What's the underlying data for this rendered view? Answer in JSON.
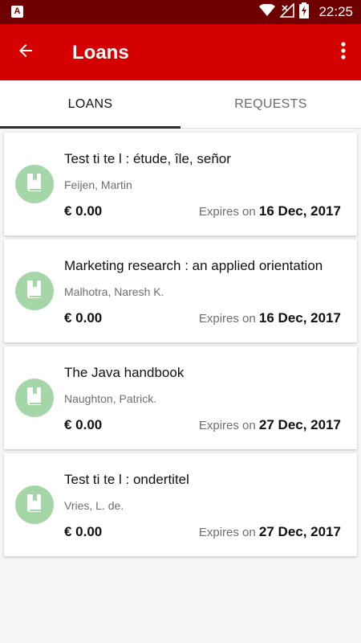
{
  "status_bar": {
    "app_badge": "A",
    "time": "22:25",
    "icons": [
      "wifi-icon",
      "signal-icon",
      "battery-charging-icon"
    ]
  },
  "app_bar": {
    "title": "Loans",
    "back_icon": "arrow-left-icon",
    "menu_icon": "more-vert-icon"
  },
  "tabs": [
    {
      "label": "LOANS",
      "active": true
    },
    {
      "label": "REQUESTS",
      "active": false
    }
  ],
  "loans": [
    {
      "title": "Test ti te l : étude, île, señor",
      "author": "Feijen, Martin",
      "fee": "€ 0.00",
      "expires_prefix": "Expires on",
      "expires_date": "16 Dec, 2017"
    },
    {
      "title": "Marketing research : an applied orientation",
      "author": "Malhotra, Naresh K.",
      "fee": "€ 0.00",
      "expires_prefix": "Expires on",
      "expires_date": "16 Dec, 2017"
    },
    {
      "title": "The Java handbook",
      "author": "Naughton, Patrick.",
      "fee": "€ 0.00",
      "expires_prefix": "Expires on",
      "expires_date": "27 Dec, 2017"
    },
    {
      "title": "Test ti te l : ondertitel",
      "author": "Vries, L. de.",
      "fee": "€ 0.00",
      "expires_prefix": "Expires on",
      "expires_date": "27 Dec, 2017"
    }
  ],
  "colors": {
    "status_bar": "#6e0000",
    "app_bar": "#d40000",
    "avatar": "#a5d6a7",
    "tab_indicator": "#2b2b2b"
  }
}
